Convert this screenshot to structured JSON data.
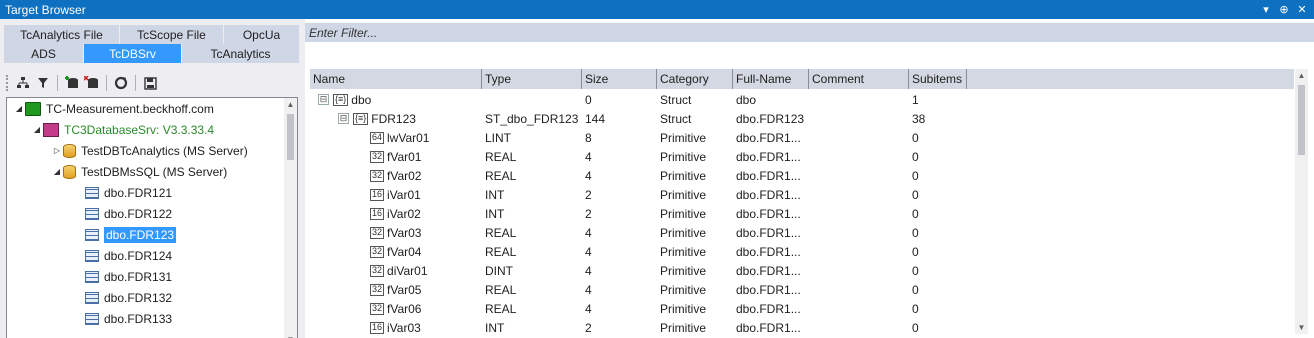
{
  "window": {
    "title": "Target Browser",
    "buttons": [
      "▾",
      "⊕",
      "✕"
    ]
  },
  "tabs_row1": [
    "TcAnalytics File",
    "TcScope File",
    "OpcUa"
  ],
  "tabs_row2": [
    "ADS",
    "TcDBSrv",
    "TcAnalytics"
  ],
  "active_tab": "TcDBSrv",
  "filter": {
    "placeholder": "Enter Filter..."
  },
  "tree": {
    "nodes": [
      {
        "label": "TC-Measurement.beckhoff.com",
        "icon": "computer-icon",
        "expand": "◢"
      },
      {
        "label": "TC3DatabaseSrv: V3.3.33.4",
        "icon": "database-server-icon",
        "expand": "◢"
      },
      {
        "label": "TestDBTcAnalytics (MS Server)",
        "icon": "database-icon",
        "expand": "▷"
      },
      {
        "label": "TestDBMsSQL (MS Server)",
        "icon": "database-icon",
        "expand": "◢"
      },
      {
        "label": "dbo.FDR121",
        "icon": "table-icon",
        "expand": ""
      },
      {
        "label": "dbo.FDR122",
        "icon": "table-icon",
        "expand": ""
      },
      {
        "label": "dbo.FDR123",
        "icon": "table-icon",
        "expand": ""
      },
      {
        "label": "dbo.FDR124",
        "icon": "table-icon",
        "expand": ""
      },
      {
        "label": "dbo.FDR131",
        "icon": "table-icon",
        "expand": ""
      },
      {
        "label": "dbo.FDR132",
        "icon": "table-icon",
        "expand": ""
      },
      {
        "label": "dbo.FDR133",
        "icon": "table-icon",
        "expand": ""
      }
    ],
    "selected": "dbo.FDR123"
  },
  "grid": {
    "columns": [
      "Name",
      "Type",
      "Size",
      "Category",
      "Full-Name",
      "Comment",
      "Subitems"
    ],
    "rows": [
      {
        "name": "dbo",
        "icon": "{≡}",
        "expand": "⊟",
        "type": "",
        "size": "0",
        "category": "Struct",
        "fullname": "dbo",
        "comment": "",
        "subitems": "1"
      },
      {
        "name": "FDR123",
        "icon": "{≡}",
        "expand": "⊟",
        "type": "ST_dbo_FDR123",
        "size": "144",
        "category": "Struct",
        "fullname": "dbo.FDR123",
        "comment": "",
        "subitems": "38"
      },
      {
        "name": "lwVar01",
        "icon": "64",
        "expand": "",
        "type": "LINT",
        "size": "8",
        "category": "Primitive",
        "fullname": "dbo.FDR1...",
        "comment": "",
        "subitems": "0"
      },
      {
        "name": "fVar01",
        "icon": "32",
        "expand": "",
        "type": "REAL",
        "size": "4",
        "category": "Primitive",
        "fullname": "dbo.FDR1...",
        "comment": "",
        "subitems": "0"
      },
      {
        "name": "fVar02",
        "icon": "32",
        "expand": "",
        "type": "REAL",
        "size": "4",
        "category": "Primitive",
        "fullname": "dbo.FDR1...",
        "comment": "",
        "subitems": "0"
      },
      {
        "name": "iVar01",
        "icon": "16",
        "expand": "",
        "type": "INT",
        "size": "2",
        "category": "Primitive",
        "fullname": "dbo.FDR1...",
        "comment": "",
        "subitems": "0"
      },
      {
        "name": "iVar02",
        "icon": "16",
        "expand": "",
        "type": "INT",
        "size": "2",
        "category": "Primitive",
        "fullname": "dbo.FDR1...",
        "comment": "",
        "subitems": "0"
      },
      {
        "name": "fVar03",
        "icon": "32",
        "expand": "",
        "type": "REAL",
        "size": "4",
        "category": "Primitive",
        "fullname": "dbo.FDR1...",
        "comment": "",
        "subitems": "0"
      },
      {
        "name": "fVar04",
        "icon": "32",
        "expand": "",
        "type": "REAL",
        "size": "4",
        "category": "Primitive",
        "fullname": "dbo.FDR1...",
        "comment": "",
        "subitems": "0"
      },
      {
        "name": "diVar01",
        "icon": "32",
        "expand": "",
        "type": "DINT",
        "size": "4",
        "category": "Primitive",
        "fullname": "dbo.FDR1...",
        "comment": "",
        "subitems": "0"
      },
      {
        "name": "fVar05",
        "icon": "32",
        "expand": "",
        "type": "REAL",
        "size": "4",
        "category": "Primitive",
        "fullname": "dbo.FDR1...",
        "comment": "",
        "subitems": "0"
      },
      {
        "name": "fVar06",
        "icon": "32",
        "expand": "",
        "type": "REAL",
        "size": "4",
        "category": "Primitive",
        "fullname": "dbo.FDR1...",
        "comment": "",
        "subitems": "0"
      },
      {
        "name": "iVar03",
        "icon": "16",
        "expand": "",
        "type": "INT",
        "size": "2",
        "category": "Primitive",
        "fullname": "dbo.FDR1...",
        "comment": "",
        "subitems": "0"
      }
    ]
  }
}
